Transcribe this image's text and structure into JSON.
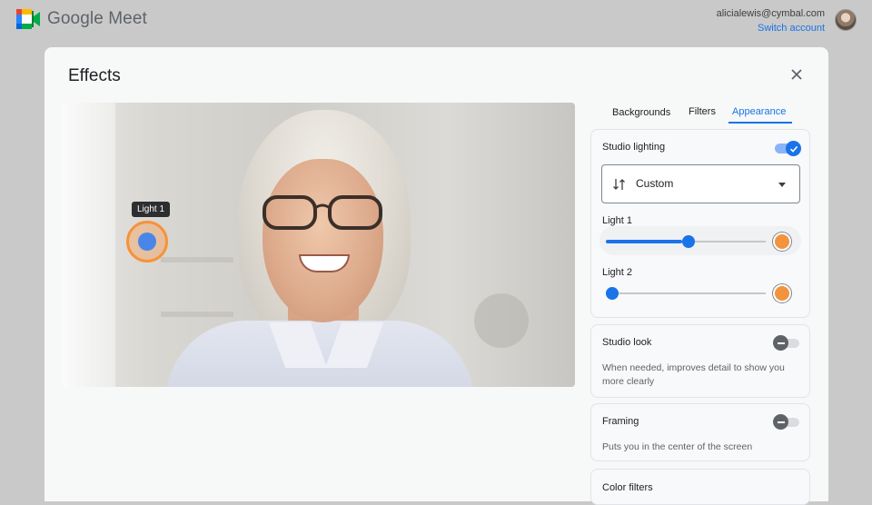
{
  "app": {
    "brand": "Google Meet",
    "brand_colors": [
      "#00832d",
      "#0066da",
      "#e94235",
      "#2684fc",
      "#00ac47",
      "#ffba00"
    ]
  },
  "account": {
    "email": "alicialewis@cymbal.com",
    "switch_label": "Switch account"
  },
  "dialog": {
    "title": "Effects",
    "close_icon": "close-icon"
  },
  "preview": {
    "light_tag": "Light 1"
  },
  "tabs": [
    {
      "label": "Backgrounds",
      "active": false
    },
    {
      "label": "Filters",
      "active": false
    },
    {
      "label": "Appearance",
      "active": true
    }
  ],
  "studio_lighting": {
    "title": "Studio lighting",
    "enabled": true,
    "mode_icon": "tune-arrows-icon",
    "mode_value": "Custom",
    "lights": [
      {
        "label": "Light 1",
        "level": 0.48,
        "color": "#f2933e"
      },
      {
        "label": "Light 2",
        "level": 0.0,
        "color": "#f2933e"
      }
    ]
  },
  "studio_look": {
    "title": "Studio look",
    "enabled": false,
    "description": "When needed, improves detail to show you more clearly"
  },
  "framing": {
    "title": "Framing",
    "enabled": false,
    "description": "Puts you in the center of the screen"
  },
  "color_filters": {
    "title": "Color filters"
  },
  "colors": {
    "accent": "#1a73e8",
    "light_color": "#f2933e"
  }
}
